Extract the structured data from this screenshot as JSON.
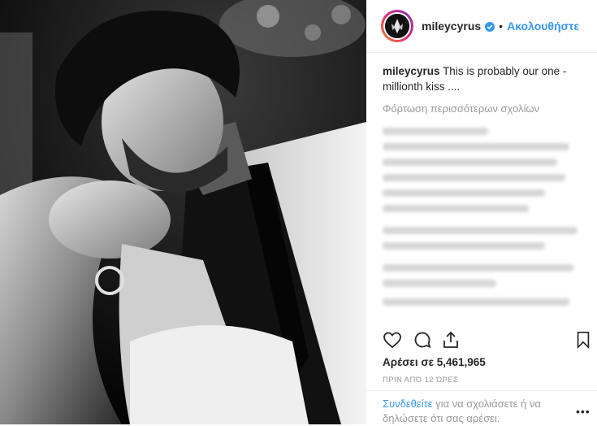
{
  "header": {
    "username": "mileycyrus",
    "verified_icon": "verified-badge-icon",
    "separator": "•",
    "follow_label": "Ακολουθήστε"
  },
  "caption": {
    "username": "mileycyrus",
    "text": "This is probably our one - millionth kiss ...."
  },
  "load_more": "Φόρτωση περισσότερων σχολίων",
  "actions": {
    "like_icon": "heart-icon",
    "comment_icon": "comment-icon",
    "share_icon": "share-icon",
    "save_icon": "bookmark-icon"
  },
  "likes": "Αρέσει σε 5,461,965",
  "time": "ΠΡΙΝ ΑΠΌ 12 ΏΡΕΣ",
  "login": {
    "link": "Συνδεθείτε",
    "text": " για να σχολιάσετε ή να δηλώσετε ότι σας αρέσει."
  },
  "more": "•••",
  "colors": {
    "accent": "#3897f0",
    "muted": "#999999",
    "text": "#262626"
  }
}
